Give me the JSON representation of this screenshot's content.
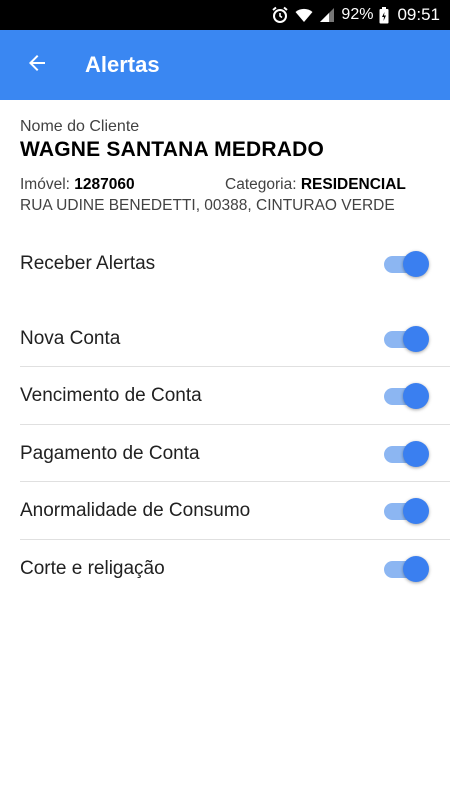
{
  "status_bar": {
    "battery": "92%",
    "time": "09:51",
    "icons": [
      "alarm-clock-icon",
      "wifi-icon",
      "signal-icon",
      "battery-icon"
    ]
  },
  "app_bar": {
    "title": "Alertas",
    "back_icon": "arrow-left-icon",
    "color": "#3a87f2"
  },
  "client": {
    "name_label": "Nome do Cliente",
    "name": "WAGNE SANTANA MEDRADO",
    "imovel_label": "Imóvel:",
    "imovel": "1287060",
    "categoria_label": "Categoria:",
    "categoria": "RESIDENCIAL",
    "address": "RUA UDINE BENEDETTI, 00388, CINTURAO VERDE"
  },
  "master_toggle": {
    "label": "Receber Alertas",
    "on": true
  },
  "alerts": [
    {
      "label": "Nova Conta",
      "on": true
    },
    {
      "label": "Vencimento de Conta",
      "on": true
    },
    {
      "label": "Pagamento de Conta",
      "on": true
    },
    {
      "label": "Anormalidade de Consumo",
      "on": true
    },
    {
      "label": "Corte e religação",
      "on": true
    }
  ],
  "colors": {
    "accent": "#3a7ff0",
    "track": "#8cb6f2"
  }
}
